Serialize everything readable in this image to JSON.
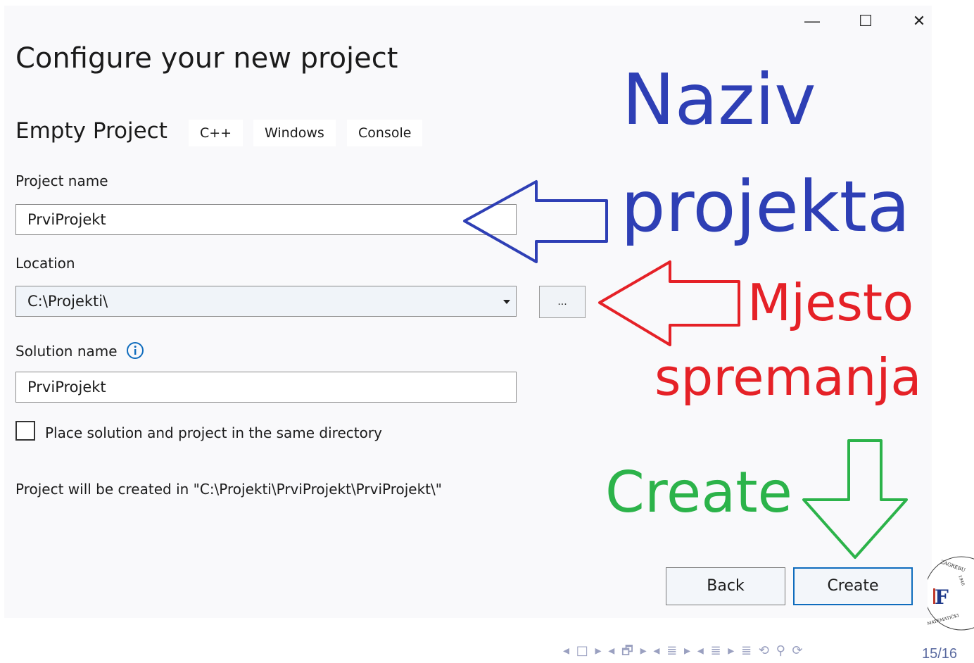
{
  "window": {
    "controls": {
      "minimize": "—",
      "maximize": "☐",
      "close": "✕"
    }
  },
  "header": {
    "title": "Configure your new project",
    "template_name": "Empty Project",
    "tags": [
      "C++",
      "Windows",
      "Console"
    ]
  },
  "form": {
    "project_name_label": "Project name",
    "project_name_value": "PrviProjekt",
    "location_label": "Location",
    "location_value": "C:\\Projekti\\",
    "browse_label": "...",
    "solution_name_label": "Solution name",
    "solution_name_value": "PrviProjekt",
    "same_directory_label": "Place solution and project in the same directory",
    "same_directory_checked": false,
    "path_note": "Project will be created in \"C:\\Projekti\\PrviProjekt\\PrviProjekt\\\""
  },
  "buttons": {
    "back": "Back",
    "create": "Create"
  },
  "annotations": {
    "naziv": "Naziv",
    "projekta": "projekta",
    "mjesto": "Mjesto",
    "spremanja": "spremanja",
    "create": "Create",
    "colors": {
      "blue": "#2e3fb5",
      "red": "#e52127",
      "green": "#2cb34a"
    }
  },
  "slide": {
    "page": "15/16",
    "nav_glyphs": "◂ □ ▸ ◂ 🗗 ▸ ◂ ≣ ▸ ◂ ≣ ▸   ≣   ⟲ ⚲ ⟳"
  }
}
